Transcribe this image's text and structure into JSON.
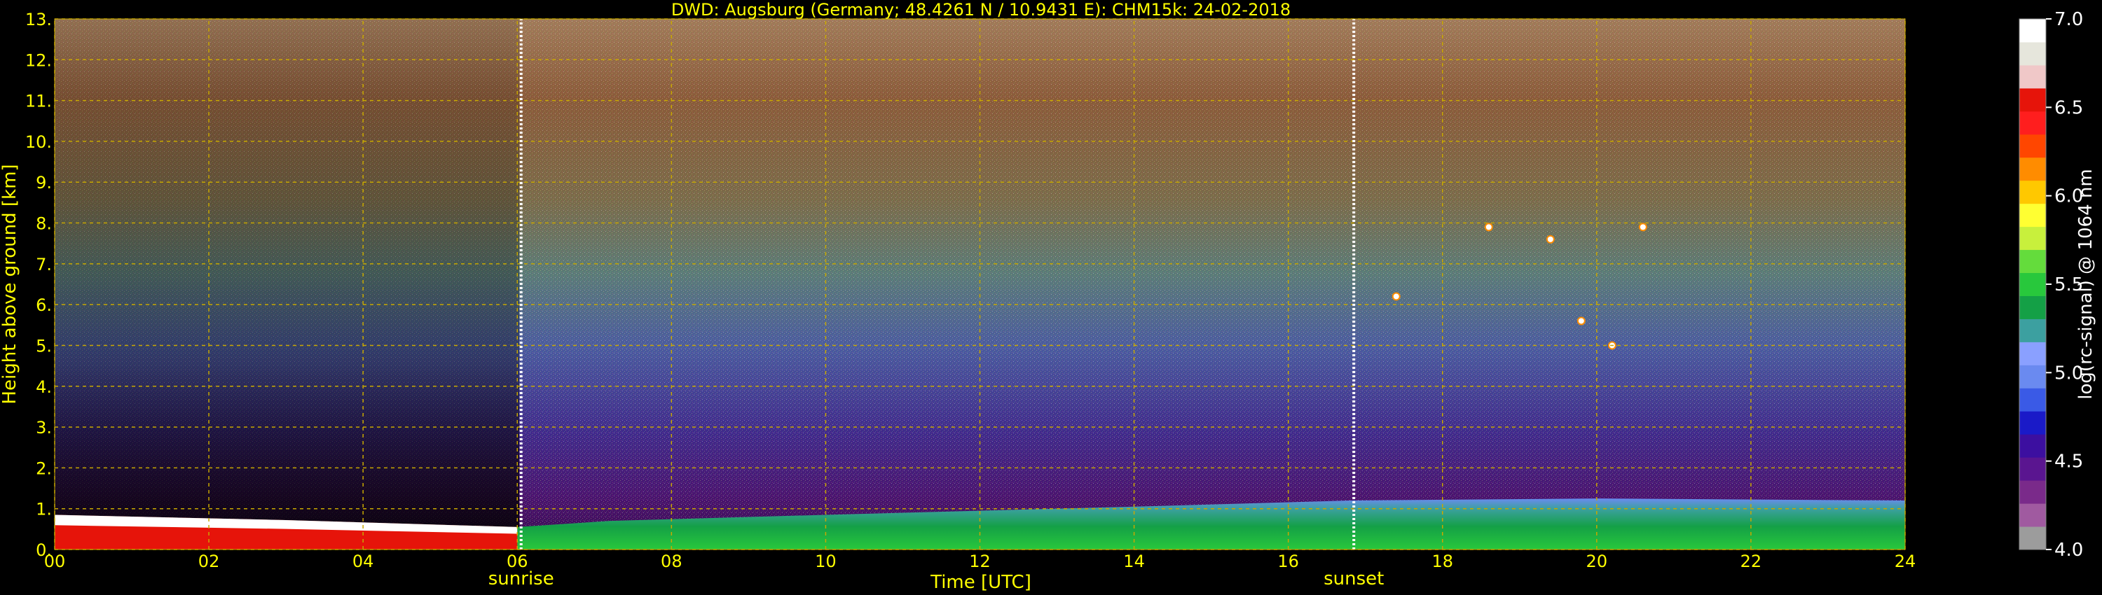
{
  "chart_data": {
    "type": "heatmap",
    "title": "DWD: Augsburg (Germany; 48.4261 N / 10.9431 E):    CHM15k: 24-02-2018",
    "xlabel": "Time [UTC]",
    "ylabel": "Height above ground [km]",
    "xlim": [
      0,
      24
    ],
    "ylim": [
      0,
      13
    ],
    "x_ticks": [
      0,
      2,
      4,
      6,
      8,
      10,
      12,
      14,
      16,
      18,
      20,
      22,
      24
    ],
    "x_tick_labels": [
      "00",
      "02",
      "04",
      "06",
      "08",
      "10",
      "12",
      "14",
      "16",
      "18",
      "20",
      "22",
      "24"
    ],
    "y_ticks": [
      0,
      1,
      2,
      3,
      4,
      5,
      6,
      7,
      8,
      9,
      10,
      11,
      12,
      13
    ],
    "y_tick_labels": [
      "0.",
      "1.",
      "2.",
      "3.",
      "4.",
      "5.",
      "6.",
      "7.",
      "8.",
      "9.",
      "10.",
      "11.",
      "12.",
      "13."
    ],
    "grid": true,
    "events": [
      {
        "label": "sunrise",
        "x": 6.05
      },
      {
        "label": "sunset",
        "x": 16.85
      }
    ],
    "colorbar": {
      "label": "log(rc-signal) @ 1064 nm",
      "range": [
        4.0,
        7.0
      ],
      "ticks": [
        4.0,
        4.5,
        5.0,
        5.5,
        6.0,
        6.5,
        7.0
      ],
      "tick_labels": [
        "4.0",
        "4.5",
        "5.0",
        "5.5",
        "6.0",
        "6.5",
        "7.0"
      ],
      "colors": [
        "#9c9c9c",
        "#a05aa0",
        "#7a2a8a",
        "#5a1590",
        "#3c0fa0",
        "#1a1ac8",
        "#3a5ae6",
        "#6a8af0",
        "#8aa0ff",
        "#3ca0a0",
        "#14a046",
        "#28c83c",
        "#64dc3c",
        "#c8f03c",
        "#ffff32",
        "#ffc800",
        "#ff8c00",
        "#ff4600",
        "#ff1e1e",
        "#e6140a",
        "#f0c8c8",
        "#e6e6dc",
        "#ffffff"
      ]
    },
    "series": [
      {
        "values": [
          {
            "t": 0.0,
            "top_km": 0.85
          },
          {
            "t": 3.0,
            "top_km": 0.72
          },
          {
            "t": 6.0,
            "top_km": 0.55
          },
          {
            "t": 7.2,
            "top_km": 0.7
          },
          {
            "t": 10.0,
            "top_km": 0.85
          },
          {
            "t": 14.0,
            "top_km": 1.05
          },
          {
            "t": 16.8,
            "top_km": 1.2
          },
          {
            "t": 20.0,
            "top_km": 1.25
          },
          {
            "t": 24.0,
            "top_km": 1.2
          }
        ]
      },
      {
        "values": [
          {
            "t": 17.4,
            "h": 6.2
          },
          {
            "t": 18.6,
            "h": 7.9
          },
          {
            "t": 19.4,
            "h": 7.6
          },
          {
            "t": 19.8,
            "h": 5.6
          },
          {
            "t": 20.2,
            "h": 5.0
          },
          {
            "t": 20.6,
            "h": 7.9
          }
        ]
      }
    ],
    "colors": {
      "text": "#ffff00",
      "grid": "#c8a800",
      "background": "#000000",
      "colorbar_text": "#ffffff"
    }
  }
}
